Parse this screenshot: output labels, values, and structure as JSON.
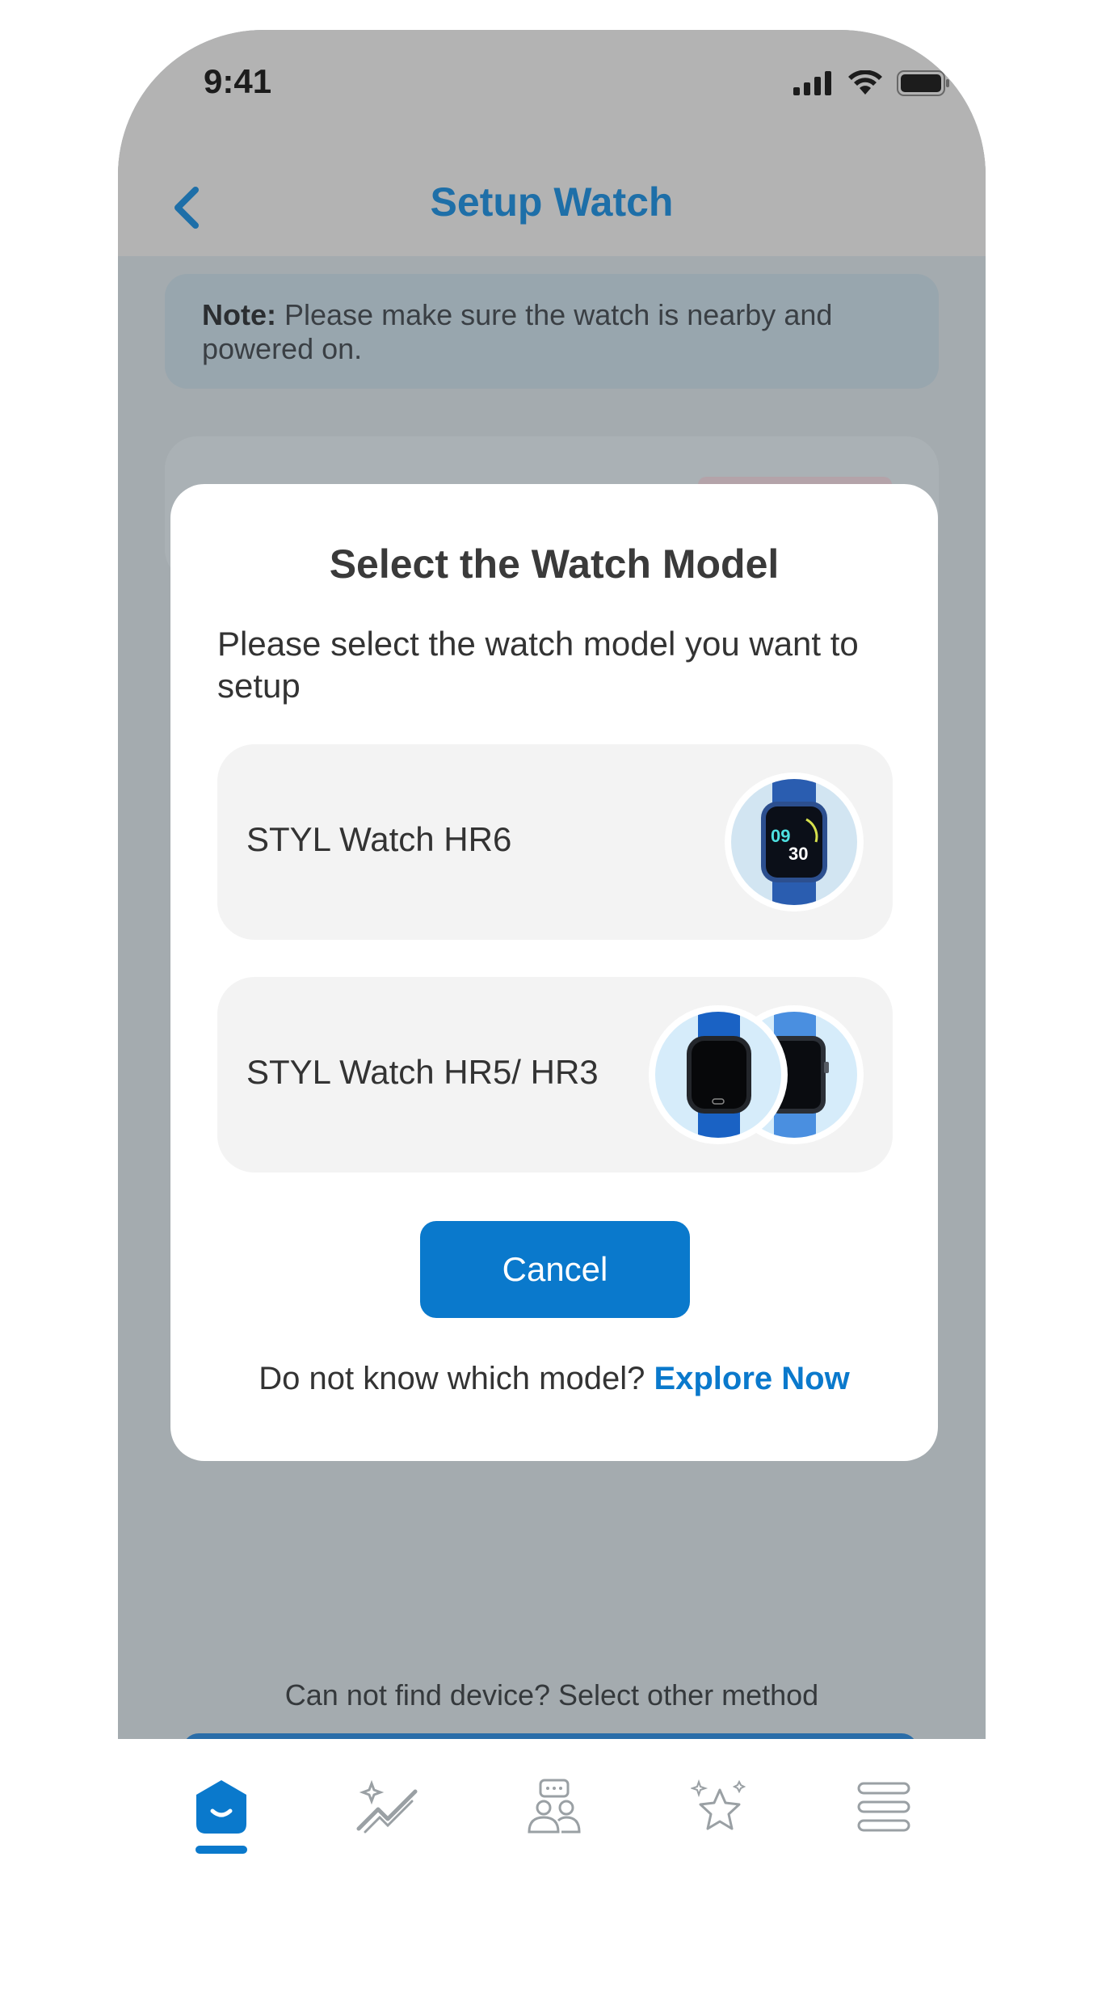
{
  "status_bar": {
    "time": "9:41"
  },
  "nav": {
    "title": "Setup Watch"
  },
  "note": {
    "label": "Note:",
    "text": " Please make sure the watch is nearby and powered on."
  },
  "background": {
    "hint": "Can not find device? Select other method"
  },
  "modal": {
    "title": "Select the Watch Model",
    "description": "Please select the watch model you want to setup",
    "options": [
      {
        "label": "STYL Watch HR6",
        "icon": "watch-hr6-image"
      },
      {
        "label": "STYL Watch HR5/ HR3",
        "icon": "watch-hr5-hr3-image"
      }
    ],
    "cancel_label": "Cancel",
    "footer_text": "Do not know which model? ",
    "footer_link": "Explore Now"
  },
  "watch_face": {
    "hour": "09",
    "minute": "30"
  },
  "tab_bar": {
    "tabs": [
      {
        "icon": "home-icon",
        "active": true
      },
      {
        "icon": "insights-icon",
        "active": false
      },
      {
        "icon": "community-icon",
        "active": false
      },
      {
        "icon": "rewards-icon",
        "active": false
      },
      {
        "icon": "menu-icon",
        "active": false
      }
    ]
  },
  "colors": {
    "accent": "#0a79cc",
    "title_blue": "#1e6fa8",
    "overlay": "#a4abaf",
    "modal_bg": "#ffffff",
    "option_bg": "#f3f3f3"
  }
}
